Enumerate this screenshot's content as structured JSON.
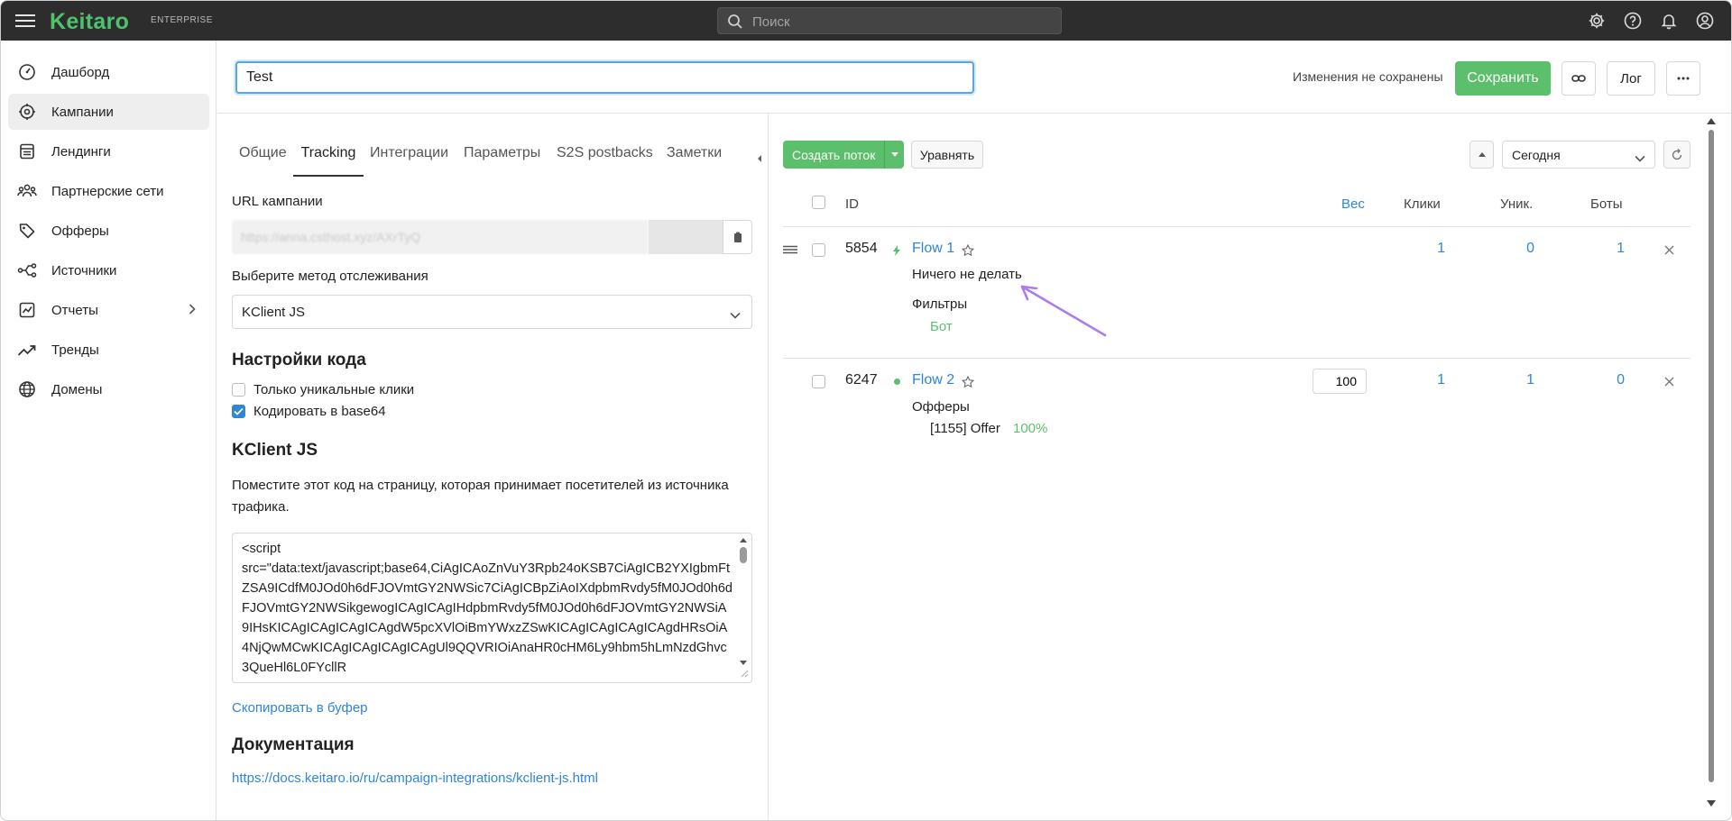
{
  "brand": {
    "name": "Keitaro",
    "edition": "ENTERPRISE",
    "color": "#4cc46c"
  },
  "search": {
    "placeholder": "Поиск"
  },
  "top_icons": [
    "gear-icon",
    "help-icon",
    "bell-icon",
    "user-icon"
  ],
  "sidebar": {
    "items": [
      {
        "label": "Дашборд",
        "icon": "dashboard-icon"
      },
      {
        "label": "Кампании",
        "icon": "target-icon",
        "active": true
      },
      {
        "label": "Лендинги",
        "icon": "landing-icon"
      },
      {
        "label": "Партнерские сети",
        "icon": "network-icon"
      },
      {
        "label": "Офферы",
        "icon": "tag-icon"
      },
      {
        "label": "Источники",
        "icon": "source-icon"
      },
      {
        "label": "Отчеты",
        "icon": "report-icon",
        "has_submenu": true
      },
      {
        "label": "Тренды",
        "icon": "trend-icon"
      },
      {
        "label": "Домены",
        "icon": "globe-icon"
      }
    ]
  },
  "header": {
    "campaign_name": "Test",
    "unsaved_text": "Изменения не сохранены",
    "save_label": "Сохранить",
    "log_label": "Лог"
  },
  "left": {
    "tabs": [
      "Общие",
      "Tracking",
      "Интеграции",
      "Параметры",
      "S2S postbacks",
      "Заметки"
    ],
    "active_tab": "Tracking",
    "url_label": "URL кампании",
    "url_value": "https://anna.csthost.xyz/AXrTyQ",
    "method_label": "Выберите метод отслеживания",
    "method_value": "KClient JS",
    "code_settings_title": "Настройки кода",
    "unique_clicks_label": "Только уникальные клики",
    "unique_clicks_checked": false,
    "base64_label": "Кодировать в base64",
    "base64_checked": true,
    "kclient_title": "KClient JS",
    "description": "Поместите этот код на страницу, которая принимает посетителей из источника трафика.",
    "code": "<script\nsrc=\"data:text/javascript;base64,CiAgICAoZnVuY3Rpb24oKSB7CiAgICB2YXIgbmFtZSA9ICdfM0JOd0h6dFJOVmtGY2NWSic7CiAgICBpZiAoIXdpbmRvdy5fM0JOd0h6dFJOVmtGY2NWSikgewogICAgICAgIHdpbmRvdy5fM0JOd0h6dFJOVmtGY2NWSiA9IHsKICAgICAgICAgICAgdW5pcXVlOiBmYWxzZSwKICAgICAgICAgICAgdHRsOiA4NjQwMCwKICAgICAgICAgICAgUl9QQVRIOiAnaHR0cHM6Ly9hbm5hLmNzdGhvc3QueHl6L0FYcllR",
    "copy_label": "Скопировать в буфер",
    "docs_title": "Документация",
    "docs_link": "https://docs.keitaro.io/ru/campaign-integrations/kclient-js.html"
  },
  "right": {
    "create_flow_label": "Создать поток",
    "equalize_label": "Уравнять",
    "date_range": "Сегодня",
    "columns": {
      "id": "ID",
      "weight": "Вес",
      "clicks": "Клики",
      "unique": "Уник.",
      "bots": "Боты"
    },
    "flows": [
      {
        "id": "5854",
        "name": "Flow 1",
        "action": "Ничего не делать",
        "filters_label": "Фильтры",
        "filter": "Бот",
        "weight": "",
        "clicks": "1",
        "unique": "0",
        "bots": "1"
      },
      {
        "id": "6247",
        "name": "Flow 2",
        "offers_label": "Офферы",
        "offer": "[1155] Offer",
        "offer_share": "100%",
        "weight": "100",
        "clicks": "1",
        "unique": "1",
        "bots": "0"
      }
    ]
  },
  "colors": {
    "accent_green": "#5cbf6c",
    "link_blue": "#2f86d6",
    "annotation_purple": "#a97cf0"
  }
}
